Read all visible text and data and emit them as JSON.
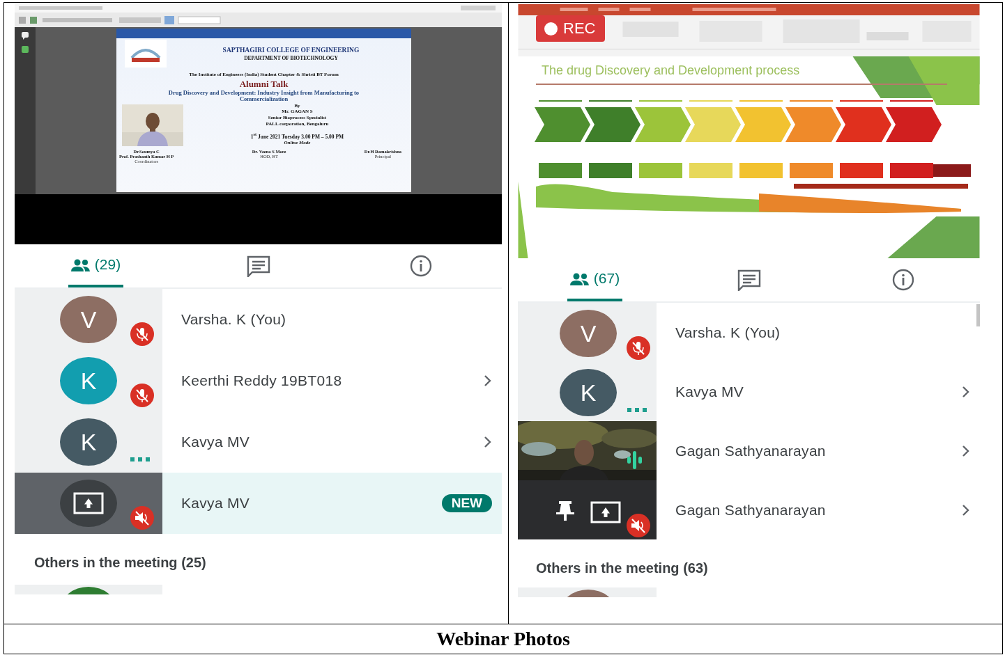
{
  "screenshots": [
    {
      "kind": "poster_share",
      "poster": {
        "college": "SAPTHAGIRI COLLEGE OF ENGINEERING",
        "department": "DEPARTMENT OF BIOTECHNOLOGY",
        "organizers": "The Institute of Engineers (India) Student Chapter & Shristi BT Forum",
        "event": "Alumni Talk",
        "topic": "Drug Discovery and Development: Industry Insight from Manufacturing to Commercialization",
        "by": "By",
        "speaker": "Mr. GAGAN S",
        "designation": "Senior Bioprocess Specialist",
        "company": "PALL corporation, Bengaluru",
        "date": "1$^{st}$ June 2021 Tuesday 3.00 PM – 5.00 PM",
        "mode": "Online Mode",
        "signatories": [
          {
            "names": [
              "Dr.Soumya C",
              "Prof. Prashanth Kumar H P"
            ],
            "role": "Coordinators"
          },
          {
            "names": [
              "Dr. Veena S More"
            ],
            "role": "HOD, BT"
          },
          {
            "names": [
              "Dr.H Ramakrishna"
            ],
            "role": "Principal"
          }
        ]
      },
      "tabs": [
        {
          "kind": "people",
          "label": "(29)",
          "selected": true
        },
        {
          "kind": "chat",
          "selected": false
        },
        {
          "kind": "info",
          "selected": false
        }
      ],
      "participants": [
        {
          "kind": "initial",
          "initial": "V",
          "color": "#8d6e63",
          "badge": {
            "kind": "mic_off"
          },
          "name": "Varsha. K (You)",
          "chevron": false,
          "highlighted": false
        },
        {
          "kind": "initial",
          "initial": "K",
          "color": "#129eaf",
          "badge": {
            "kind": "mic_off"
          },
          "name": "Keerthi Reddy 19BT018",
          "chevron": true,
          "highlighted": false
        },
        {
          "kind": "initial",
          "initial": "K",
          "color": "#455a64",
          "badge": {
            "kind": "dots"
          },
          "name": "Kavya MV",
          "chevron": true,
          "highlighted": false
        },
        {
          "kind": "presenting",
          "badge": {
            "kind": "audio_off"
          },
          "name": "Kavya MV",
          "chevron": false,
          "highlighted": true,
          "tag": "NEW"
        }
      ],
      "others_heading": "Others in the meeting (25)",
      "next_avatar": {
        "color": "#2e7d32"
      }
    },
    {
      "kind": "slide_share",
      "rec_label": "REC",
      "slide_title": "The drug Discovery and Development process",
      "tabs": [
        {
          "kind": "people",
          "label": "(67)",
          "selected": true
        },
        {
          "kind": "chat",
          "selected": false
        },
        {
          "kind": "info",
          "selected": false
        }
      ],
      "participants": [
        {
          "kind": "initial",
          "initial": "V",
          "color": "#8d6e63",
          "badge": {
            "kind": "mic_off"
          },
          "name": "Varsha. K (You)",
          "chevron": false,
          "highlighted": false
        },
        {
          "kind": "initial",
          "initial": "K",
          "color": "#455a64",
          "badge": {
            "kind": "dots"
          },
          "name": "Kavya MV",
          "chevron": true,
          "highlighted": false
        },
        {
          "kind": "video",
          "badge": {
            "kind": "speaking"
          },
          "name": "Gagan Sathyanarayan",
          "chevron": true,
          "highlighted": false
        },
        {
          "kind": "presenting_pinned",
          "badge": {
            "kind": "audio_off"
          },
          "name": "Gagan Sathyanarayan",
          "chevron": true,
          "highlighted": false
        }
      ],
      "others_heading": "Others in the meeting (63)",
      "next_avatar": {
        "color": "#8d6e63"
      }
    }
  ],
  "caption": "Webinar Photos"
}
